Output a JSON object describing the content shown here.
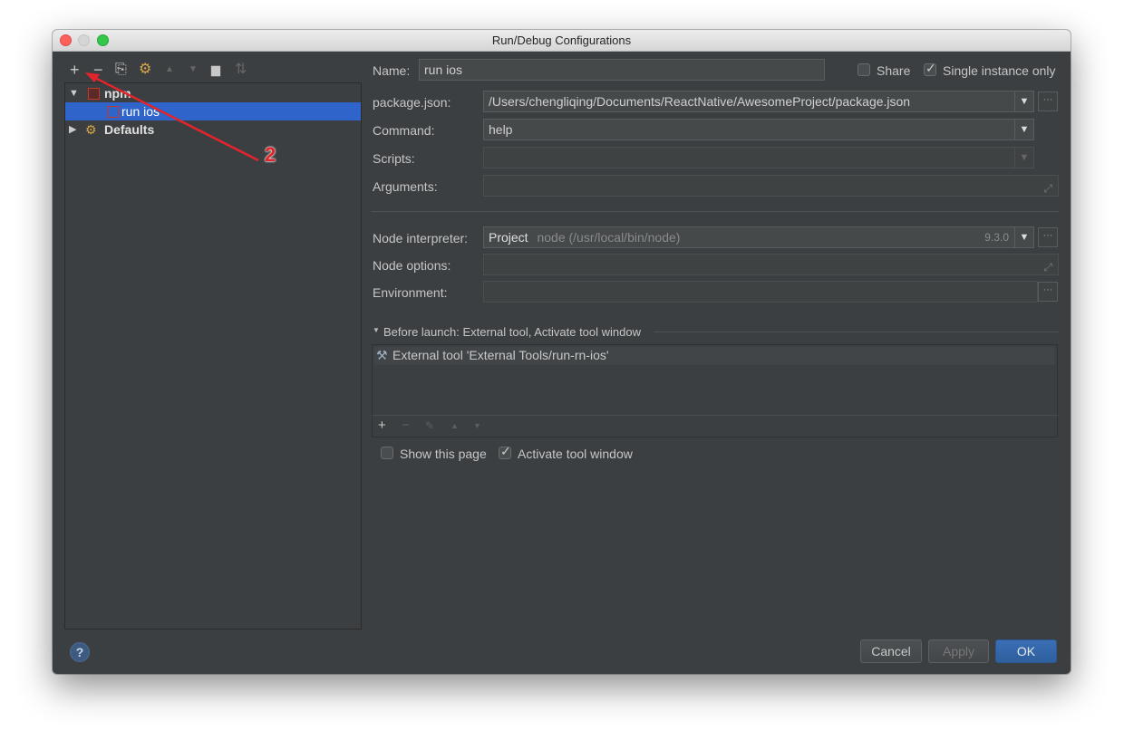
{
  "window": {
    "title": "Run/Debug Configurations"
  },
  "toolbar": {
    "icons": [
      "plus-icon",
      "minus-icon",
      "copy-icon",
      "wrench-icon",
      "arrow-up-icon",
      "arrow-down-icon",
      "folder-icon",
      "sort-icon"
    ],
    "glyphs": {
      "add": "+",
      "remove": "−",
      "copy": "⎘",
      "wrench": "⚙",
      "up": "▲",
      "down": "▼",
      "folder": "▆",
      "sort": "⇅"
    }
  },
  "tree": {
    "npm_label": "npm",
    "run_ios_label": "run ios",
    "defaults_label": "Defaults"
  },
  "annotation": {
    "label": "2",
    "color": "#e3252b"
  },
  "form": {
    "name_label": "Name:",
    "name_value": "run ios",
    "share_label": "Share",
    "single_instance_label": "Single instance only",
    "package_label": "package.json:",
    "package_value": "/Users/chengliqing/Documents/ReactNative/AwesomeProject/package.json",
    "command_label": "Command:",
    "command_value": "help",
    "scripts_label": "Scripts:",
    "arguments_label": "Arguments:",
    "node_interp_label": "Node interpreter:",
    "node_interp_project": "Project",
    "node_interp_path": "node (/usr/local/bin/node)",
    "node_interp_version": "9.3.0",
    "node_options_label": "Node options:",
    "environment_label": "Environment:",
    "before_launch_label": "Before launch: External tool, Activate tool window",
    "external_tool_item": "External tool 'External Tools/run-rn-ios'",
    "show_page_label": "Show this page",
    "activate_window_label": "Activate tool window"
  },
  "buttons": {
    "cancel": "Cancel",
    "apply": "Apply",
    "ok": "OK",
    "help": "?"
  },
  "colors": {
    "selection": "#2f65ca",
    "background": "#3c3f41",
    "primary": "#2e5f9e"
  }
}
